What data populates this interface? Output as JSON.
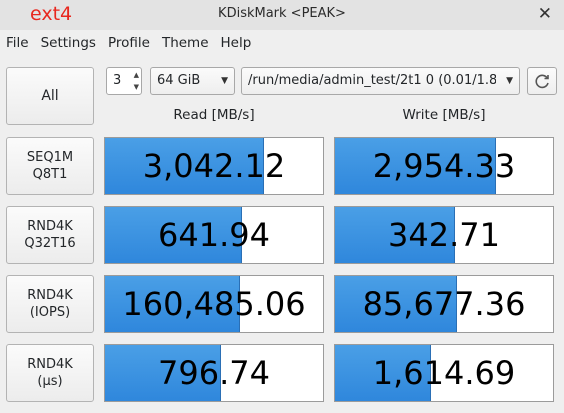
{
  "overlay_label": "ext4",
  "window": {
    "title": "KDiskMark <PEAK>"
  },
  "menu": [
    "File",
    "Settings",
    "Profile",
    "Theme",
    "Help"
  ],
  "controls": {
    "all_label": "All",
    "runs": "3",
    "size": "64 GiB",
    "target": "/run/media/admin_test/2t1 0 (0.01/1.8"
  },
  "headers": {
    "read": "Read [MB/s]",
    "write": "Write [MB/s]"
  },
  "colors": {
    "bar": "#3b93e0",
    "overlay": "#e8271e"
  },
  "tests": [
    {
      "line1": "SEQ1M",
      "line2": "Q8T1",
      "read": "3,042.12",
      "write": "2,954.33",
      "read_fill": 0.73,
      "write_fill": 0.74
    },
    {
      "line1": "RND4K",
      "line2": "Q32T16",
      "read": "641.94",
      "write": "342.71",
      "read_fill": 0.63,
      "write_fill": 0.55
    },
    {
      "line1": "RND4K",
      "line2": "(IOPS)",
      "read": "160,485.06",
      "write": "85,677.36",
      "read_fill": 0.62,
      "write_fill": 0.56
    },
    {
      "line1": "RND4K",
      "line2": "(µs)",
      "read": "796.74",
      "write": "1,614.69",
      "read_fill": 0.53,
      "write_fill": 0.44
    }
  ]
}
